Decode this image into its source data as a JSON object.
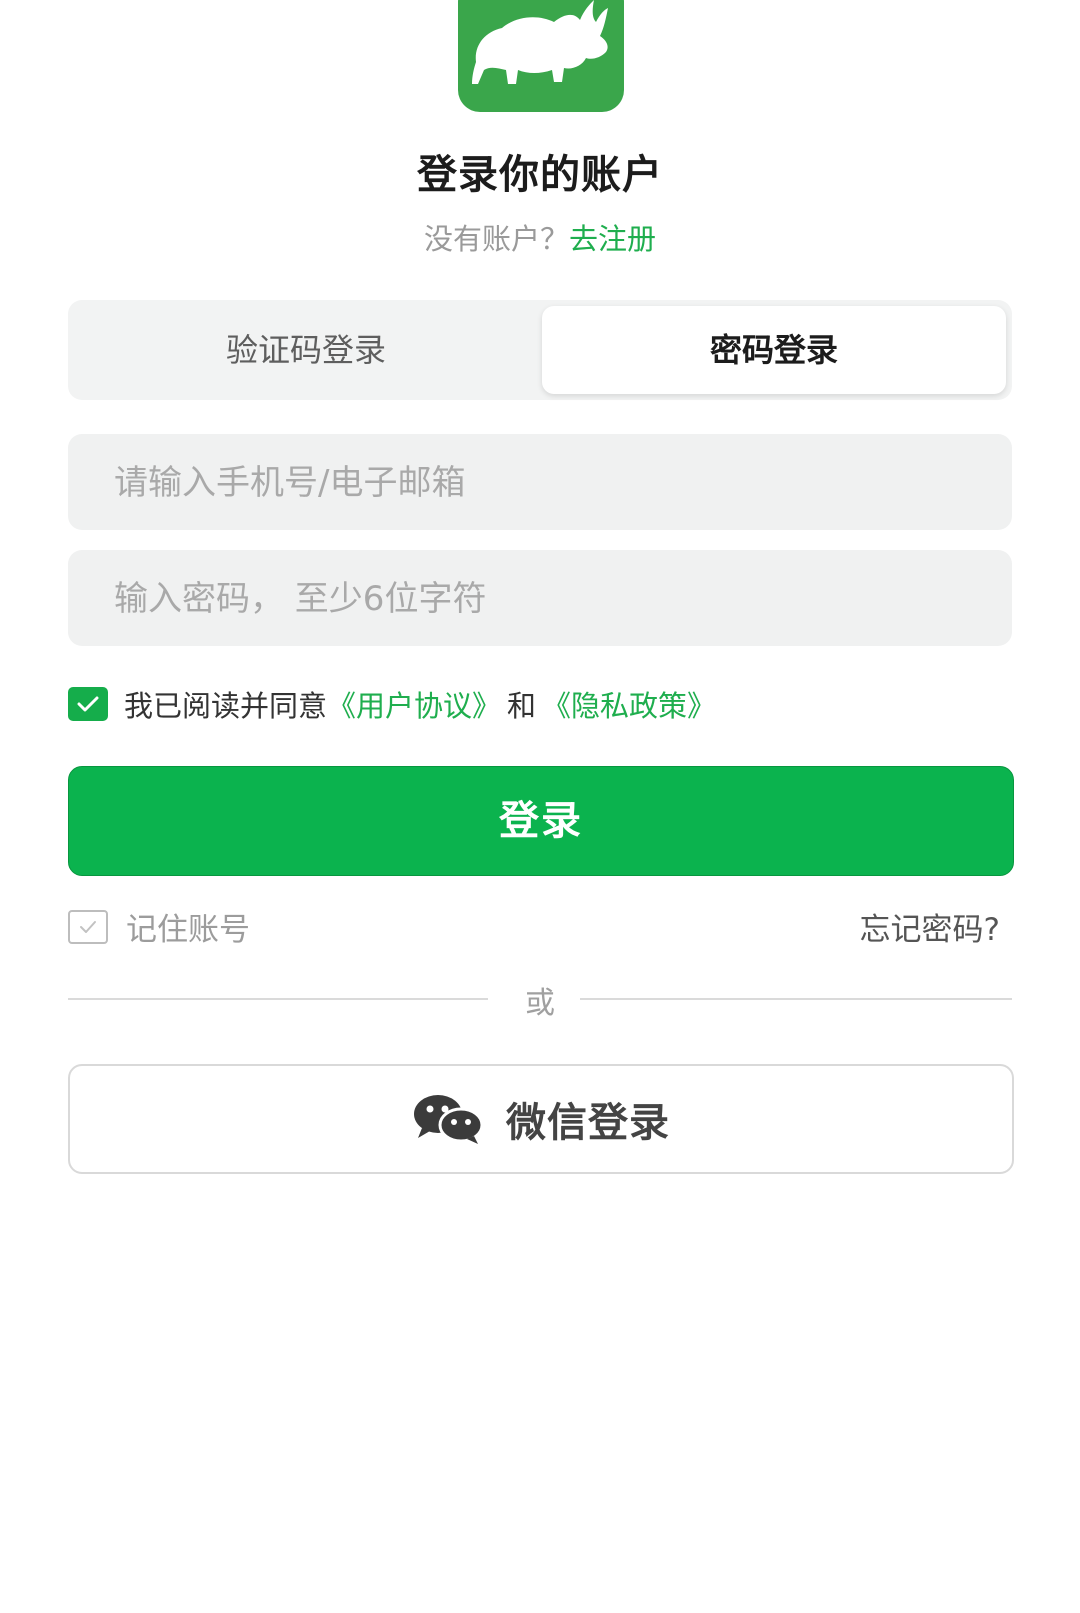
{
  "header": {
    "title": "登录你的账户",
    "no_account_text": "没有账户？",
    "register_link": "去注册"
  },
  "tabs": [
    {
      "label": "验证码登录",
      "selected": false
    },
    {
      "label": "密码登录",
      "selected": true
    }
  ],
  "form": {
    "account_placeholder": "请输入手机号/电子邮箱",
    "account_value": "",
    "password_placeholder": "输入密码， 至少6位字符",
    "password_value": ""
  },
  "agreement": {
    "checked": true,
    "prefix": "我已阅读并同意",
    "user_agreement": "《用户协议》",
    "and": "和",
    "privacy_policy": "《隐私政策》"
  },
  "login_button": "登录",
  "remember": {
    "label": "记住账号",
    "checked": false
  },
  "forgot_password": "忘记密码?",
  "divider_text": "或",
  "wechat_button": "微信登录",
  "colors": {
    "brand_green": "#0bb34e",
    "logo_green": "#3aa64b",
    "link_green": "#1fae4e"
  },
  "icons": [
    "rhino-logo-icon",
    "check-icon",
    "wechat-icon"
  ]
}
